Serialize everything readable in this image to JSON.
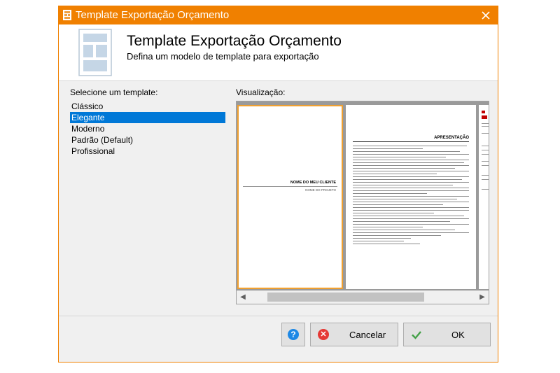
{
  "window": {
    "title": "Template Exportação Orçamento"
  },
  "header": {
    "title": "Template Exportação Orçamento",
    "subtitle": "Defina um modelo de template para exportação"
  },
  "templates": {
    "label": "Selecione um template:",
    "items": [
      "Clássico",
      "Elegante",
      "Moderno",
      "Padrão (Default)",
      "Profissional"
    ],
    "selected_index": 1
  },
  "preview": {
    "label": "Visualização:",
    "cover_client": "NOME DO MEU CLIENTE",
    "cover_project": "NOME DO PROJETO",
    "content_heading": "APRESENTAÇÃO"
  },
  "buttons": {
    "help_icon": "?",
    "cancel_label": "Cancelar",
    "ok_label": "OK"
  },
  "colors": {
    "accent": "#f08000",
    "selection": "#0078d7",
    "cancel_icon": "#e53935",
    "ok_icon": "#43a047",
    "help_icon": "#1e88e5"
  }
}
